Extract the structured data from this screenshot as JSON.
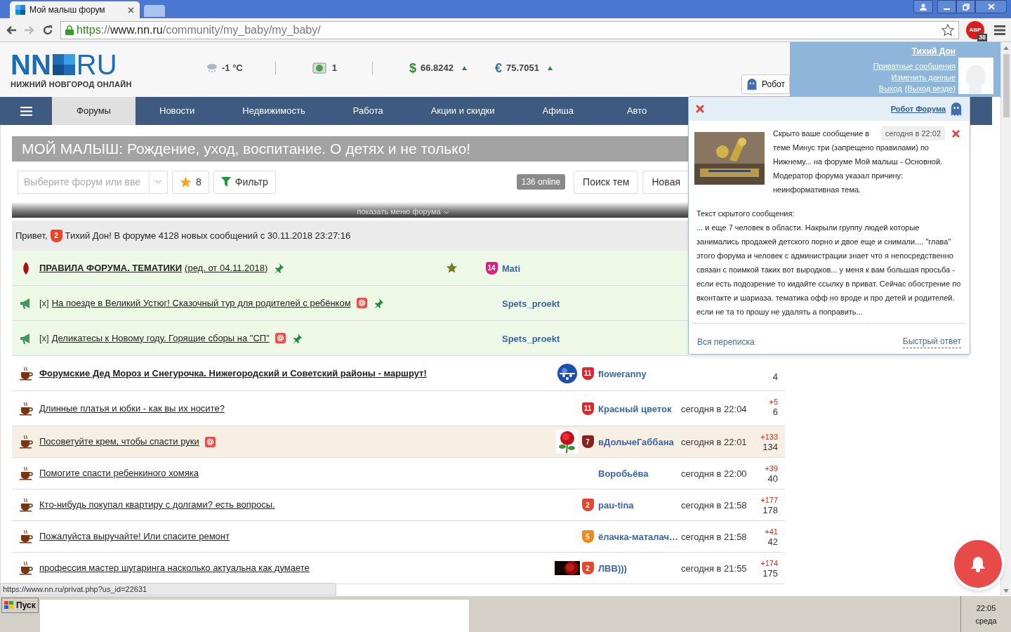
{
  "browser": {
    "tab_title": "Мой малыш форум",
    "url": {
      "scheme": "https",
      "sep": "://",
      "host": "www.nn.ru",
      "path": "/community/my_baby/my_baby/"
    },
    "abp": {
      "label": "ABP",
      "count": "38"
    }
  },
  "header": {
    "logo": {
      "left": "NN",
      "right": "RU",
      "subtitle": "НИЖНИЙ НОВГОРОД ОНЛАЙН"
    },
    "weather": "-1 °C",
    "traffic": "1",
    "currencies": [
      {
        "symbol": "$",
        "value": "66.8242",
        "color": "#2e8b2e"
      },
      {
        "symbol": "€",
        "value": "75.7051",
        "color": "#3a6ea5"
      }
    ],
    "robot_tab": "Робот"
  },
  "user": {
    "name": "Тихий Дон",
    "links": [
      "Приватные сообщения",
      "Изменить данные"
    ],
    "logout": "Выход",
    "logout_all": "(Выход везде)"
  },
  "nav": [
    {
      "label": "Форумы",
      "selected": true
    },
    {
      "label": "Новости",
      "selected": false
    },
    {
      "label": "Недвижимость",
      "selected": false
    },
    {
      "label": "Работа",
      "selected": false
    },
    {
      "label": "Акции и скидки",
      "selected": false
    },
    {
      "label": "Афиша",
      "selected": false
    },
    {
      "label": "Авто",
      "selected": false
    }
  ],
  "forum": {
    "title": "МОЙ МАЛЫШ: Рождение, уход, воспитание. О детях и не только!",
    "select_placeholder": "Выберите форум или вве",
    "favorites": "8",
    "filter": "Фильтр",
    "online": "136 online",
    "search": "Поиск тем",
    "new_topic": "Новая",
    "menu_toggle": "показать меню форума",
    "greeting_start": "Привет,",
    "greeting_rank": "2",
    "greeting_rest": "Тихий Дон! В форуме 4128 новых сообщений с 30.11.2018 23:27:16"
  },
  "topics": [
    {
      "kind": "rules",
      "title": "ПРАВИЛА ФОРУМА. ТЕМАТИКИ",
      "note": "(ред. от 04.11.2018)",
      "bold": true,
      "mention": false,
      "pinned": true,
      "starred": true,
      "rank": {
        "label": "14",
        "color": "#d6247e"
      },
      "author": "Mati",
      "highlighted": false
    },
    {
      "kind": "announce",
      "prefix": "[x]",
      "title": "На поезде в Великий Устюг! Сказочный тур для родителей с ребёнком",
      "bold": false,
      "mention": true,
      "pinned": true,
      "starred": false,
      "author": "Spets_proekt",
      "highlighted": false
    },
    {
      "kind": "announce",
      "prefix": "[x]",
      "title": "Деликатесы к Новому году. Горящие сборы на \"СП\"",
      "bold": false,
      "mention": true,
      "pinned": true,
      "starred": false,
      "author": "Spets_proekt",
      "highlighted": false
    },
    {
      "kind": "normal",
      "title": "Форумские Дед Мороз и Снегурочка. Нижегородский и Советский районы - маршрут!",
      "bold": true,
      "mention": false,
      "pinned": false,
      "starred": false,
      "rank": {
        "label": "11",
        "color": "#e0262b"
      },
      "author": "floweranny",
      "total": "4",
      "highlighted": false
    },
    {
      "kind": "normal",
      "title": "Длинные платья и юбки - как вы их носите?",
      "bold": false,
      "mention": false,
      "pinned": false,
      "starred": false,
      "rank": {
        "label": "11",
        "color": "#e0262b"
      },
      "author": "Красный цветок",
      "time": "сегодня в 22:04",
      "new": "+5",
      "total": "6",
      "highlighted": false
    },
    {
      "kind": "normal",
      "title": "Посоветуйте крем, чтобы спасти руки",
      "bold": false,
      "mention": true,
      "pinned": false,
      "starred": false,
      "rank": {
        "label": "7",
        "color": "#8a1f1f"
      },
      "author": "вДольчеГаббана",
      "time": "сегодня в 22:01",
      "new": "+133",
      "total": "134",
      "highlighted": true
    },
    {
      "kind": "normal",
      "title": "Помогите спасти ребенкиного хомяка",
      "bold": false,
      "mention": false,
      "pinned": false,
      "starred": false,
      "author": "Воробьёва",
      "time": "сегодня в 22:00",
      "new": "+39",
      "total": "40",
      "highlighted": false
    },
    {
      "kind": "normal",
      "title": "Кто-нибудь покупал квартиру с долгами? есть вопросы.",
      "bold": false,
      "mention": false,
      "pinned": false,
      "starred": false,
      "rank": {
        "label": "2",
        "color": "#e8452a"
      },
      "author": "pau-tina",
      "time": "сегодня в 21:58",
      "new": "+177",
      "total": "178",
      "highlighted": false
    },
    {
      "kind": "normal",
      "title": "Пожалуйста выручайте! Или спасите ремонт",
      "bold": false,
      "mention": false,
      "pinned": false,
      "starred": false,
      "rank": {
        "label": "5",
        "color": "#f08a1c"
      },
      "author": "ёлачка-маталач…",
      "time": "сегодня в 21:58",
      "new": "+41",
      "total": "42",
      "highlighted": false
    },
    {
      "kind": "normal",
      "title": "профессия мастер шугаринга насколько актуальна как думаете",
      "bold": false,
      "mention": false,
      "pinned": false,
      "starred": false,
      "rank": {
        "label": "2",
        "color": "#e8452a"
      },
      "author": "ЛВВ)))",
      "time": "сегодня в 21:55",
      "new": "+174",
      "total": "175",
      "highlighted": false
    }
  ],
  "popup": {
    "sender": "Робот Форума",
    "time": "сегодня в 22:02",
    "notice_first": "Скрыто ваше сообщение в",
    "notice_rest": "теме Минус три (запрещено правилами) по Нижнему... на форуме Мой малыш - Основной. Модератор форума указал причину: неинформативная тема.",
    "body_title": "Текст скрытого сообщения:",
    "body": "... и еще 7 человек в области. Накрыли группу людей которые занимались продажей детского порно и двое еще и снимали.... \"глава\" этого форума и человек с администрации знает что я непосредственно связан с поимкой таких вот выродков... у меня к вам большая просьба - если есть подозрение то кидайте ссылку в приват. Сейчас обострение по вконтакте и шариаза. тематика офф но вроде и про детей и родителей. если не та то прошу не удалять а поправить...",
    "all_link": "Вся переписка",
    "reply_link": "Быстрый ответ"
  },
  "status_bar": "https://www.nn.ru/privat.php?us_id=22631",
  "taskbar": {
    "start": "Пуск",
    "time": "22:05",
    "day": "среда"
  }
}
